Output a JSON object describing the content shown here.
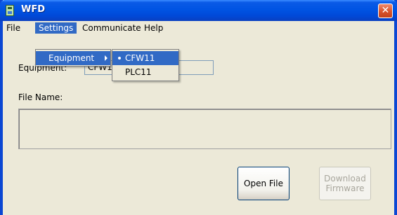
{
  "window": {
    "title": "WFD",
    "close_symbol": "✕"
  },
  "menubar": [
    "File",
    "Settings",
    "Communicate",
    "Help"
  ],
  "settings_menu": {
    "items": [
      "Equipment"
    ]
  },
  "equipment_submenu": {
    "items": [
      "CFW11",
      "PLC11"
    ],
    "selected": "CFW11"
  },
  "form": {
    "equipment_label": "Equipment:",
    "equipment_value": "CFW11",
    "file_name_label": "File Name:",
    "file_name_value": ""
  },
  "buttons": {
    "open_file": "Open File",
    "download_line1": "Download",
    "download_line2": "Firmware"
  },
  "colors": {
    "titlebar": "#0054e3",
    "menu_highlight": "#316ac5",
    "window_bg": "#ece9d8",
    "close_button": "#d9532b"
  }
}
